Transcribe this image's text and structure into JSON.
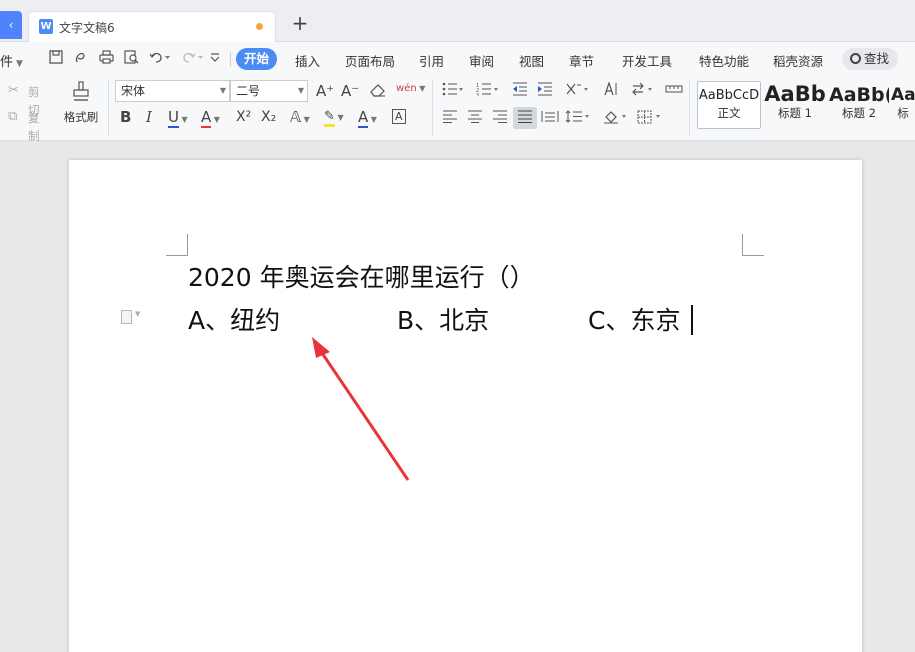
{
  "tabbar": {
    "home_label": "‹",
    "doc_tab_title": "文字文稿6",
    "doc_icon_letter": "W",
    "new_tab_symbol": "+"
  },
  "menu": {
    "file_label": "件",
    "items": [
      "开始",
      "插入",
      "页面布局",
      "引用",
      "审阅",
      "视图",
      "章节",
      "开发工具",
      "特色功能",
      "稻壳资源"
    ],
    "active_item": "开始",
    "search_label": "查找"
  },
  "ribbon": {
    "cut_label": "剪切",
    "copy_label": "复制",
    "format_painter_label": "格式刷",
    "font_name": "宋体",
    "font_size": "二号",
    "bold": "B",
    "italic": "I",
    "underline": "U",
    "strikethrough": "A",
    "superscript": "X²",
    "subscript": "X₂",
    "font_color_letter": "A",
    "grow_font": "A⁺",
    "shrink_font": "A⁻",
    "phonetic": "wén",
    "styles": [
      {
        "preview": "AaBbCcD",
        "name": "正文"
      },
      {
        "preview": "AaBb",
        "name": "标题 1"
      },
      {
        "preview": "AaBb(",
        "name": "标题 2"
      },
      {
        "preview": "Aa",
        "name": "标"
      }
    ]
  },
  "document": {
    "lines": [
      "2020 年奥运会在哪里运行（）",
      "A、纽约",
      "B、北京",
      "C、东京"
    ]
  },
  "colors": {
    "accent": "#4a8bf5",
    "annotation_arrow": "#e8343a",
    "font_color_bar": "#2b55d1"
  }
}
